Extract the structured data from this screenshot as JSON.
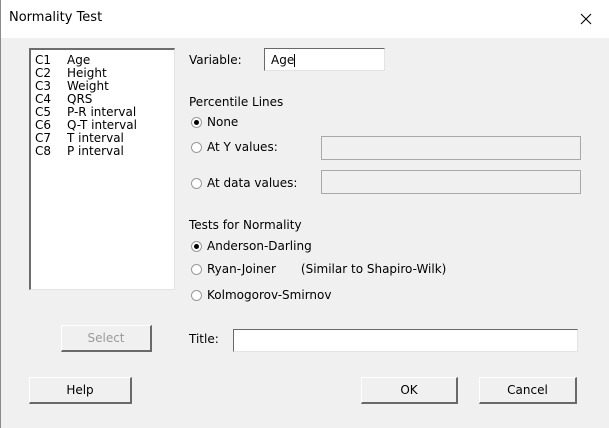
{
  "window": {
    "title": "Normality Test"
  },
  "variables_list": [
    {
      "col": "C1",
      "name": "Age"
    },
    {
      "col": "C2",
      "name": "Height"
    },
    {
      "col": "C3",
      "name": "Weight"
    },
    {
      "col": "C4",
      "name": "QRS"
    },
    {
      "col": "C5",
      "name": "P-R interval"
    },
    {
      "col": "C6",
      "name": "Q-T interval"
    },
    {
      "col": "C7",
      "name": "T interval"
    },
    {
      "col": "C8",
      "name": "P interval"
    }
  ],
  "variable": {
    "label": "Variable:",
    "value": "Age"
  },
  "percentile_lines": {
    "heading": "Percentile Lines",
    "options": [
      {
        "label": "None",
        "selected": true
      },
      {
        "label": "At Y values:",
        "selected": false
      },
      {
        "label": "At data values:",
        "selected": false
      }
    ],
    "y_values": "",
    "data_values": ""
  },
  "tests": {
    "heading": "Tests for Normality",
    "options": [
      {
        "label": "Anderson-Darling",
        "selected": true
      },
      {
        "label": "Ryan-Joiner",
        "note": "(Similar to Shapiro-Wilk)",
        "selected": false
      },
      {
        "label": "Kolmogorov-Smirnov",
        "selected": false
      }
    ]
  },
  "title_field": {
    "label": "Title:",
    "value": ""
  },
  "buttons": {
    "select": "Select",
    "help": "Help",
    "ok": "OK",
    "cancel": "Cancel"
  }
}
